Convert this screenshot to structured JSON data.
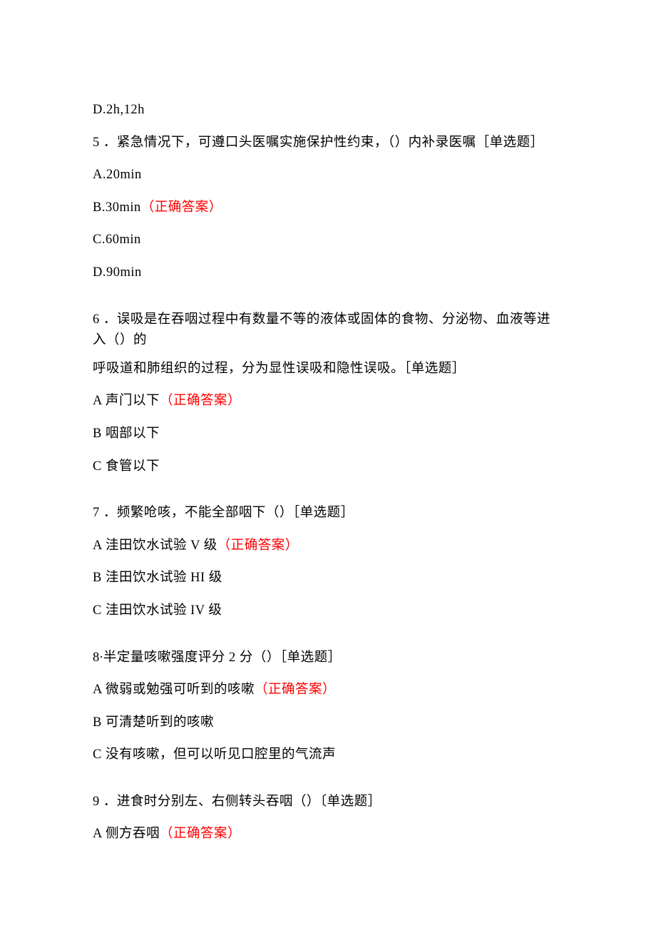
{
  "q4": {
    "optD": "D.2h,12h"
  },
  "q5": {
    "stem_a": "5 ．紧急情况下，可遵口头医嘱实施保护性约束，（）内补录医嘱［单选题］",
    "optA": "A.20min",
    "optB_text": "B.30min",
    "optB_correct": "（正确答案）",
    "optC": "C.60min",
    "optD": "D.90min"
  },
  "q6": {
    "stem_line1": "6 ．误吸是在吞咽过程中有数量不等的液体或固体的食物、分泌物、血液等进入（）的",
    "stem_line2": "呼吸道和肺组织的过程，分为显性误吸和隐性误吸。［单选题］",
    "optA_text": "A 声门以下",
    "optA_correct": "（正确答案）",
    "optB": "B 咽部以下",
    "optC": "C 食管以下"
  },
  "q7": {
    "stem": "7 ．频繁呛咳，不能全部咽下（）［单选题］",
    "optA_text": "A 洼田饮水试验 V 级",
    "optA_correct": "（正确答案）",
    "optB": "B 洼田饮水试验 HI 级",
    "optC": "C 洼田饮水试验 IV 级"
  },
  "q8": {
    "stem": "8∙半定量咳嗽强度评分 2 分（）［单选题］",
    "optA_text": "A 微弱或勉强可听到的咳嗽",
    "optA_correct": "（正确答案）",
    "optB": "B 可清楚听到的咳嗽",
    "optC": "C 没有咳嗽，但可以听见口腔里的气流声"
  },
  "q9": {
    "stem": "9 ．进食时分别左、右侧转头吞咽（）〔单选题］",
    "optA_text": "A 侧方吞咽",
    "optA_correct": "（正确答案）"
  }
}
